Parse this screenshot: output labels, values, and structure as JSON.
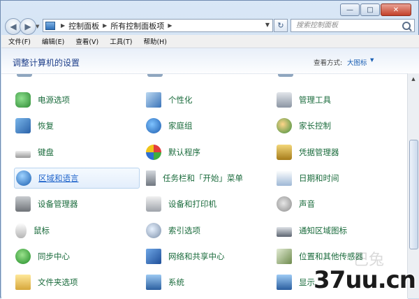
{
  "window": {
    "caption_buttons": {
      "minimize": "—",
      "maximize": "□",
      "close": "✕"
    }
  },
  "address_bar": {
    "breadcrumbs": [
      "控制面板",
      "所有控制面板项"
    ],
    "search_placeholder": "搜索控制面板"
  },
  "menu": [
    "文件(F)",
    "编辑(E)",
    "查看(V)",
    "工具(T)",
    "帮助(H)"
  ],
  "content": {
    "heading": "调整计算机的设置",
    "view_by_label": "查看方式:",
    "view_by_value": "大图标"
  },
  "items": {
    "col1": [
      "电源选项",
      "恢复",
      "键盘",
      "区域和语言",
      "设备管理器",
      "鼠标",
      "同步中心",
      "文件夹选项"
    ],
    "col2": [
      "个性化",
      "家庭组",
      "默认程序",
      "任务栏和「开始」菜单",
      "设备和打印机",
      "索引选项",
      "网络和共享中心",
      "系统"
    ],
    "col3": [
      "管理工具",
      "家长控制",
      "凭据管理器",
      "日期和时间",
      "声音",
      "通知区域图标",
      "位置和其他传感器",
      "显示"
    ],
    "selected": "区域和语言"
  },
  "icons": {
    "col1": [
      "power-options-icon",
      "recovery-icon",
      "keyboard-icon",
      "region-language-icon",
      "device-manager-icon",
      "mouse-icon",
      "sync-center-icon",
      "folder-options-icon"
    ],
    "col2": [
      "personalization-icon",
      "homegroup-icon",
      "default-programs-icon",
      "taskbar-start-menu-icon",
      "devices-printers-icon",
      "indexing-options-icon",
      "network-sharing-icon",
      "system-icon"
    ],
    "col3": [
      "admin-tools-icon",
      "parental-controls-icon",
      "credential-manager-icon",
      "date-time-icon",
      "sound-icon",
      "notification-area-icon",
      "location-sensors-icon",
      "display-icon"
    ]
  },
  "watermark": {
    "text": "37uu.cn"
  }
}
